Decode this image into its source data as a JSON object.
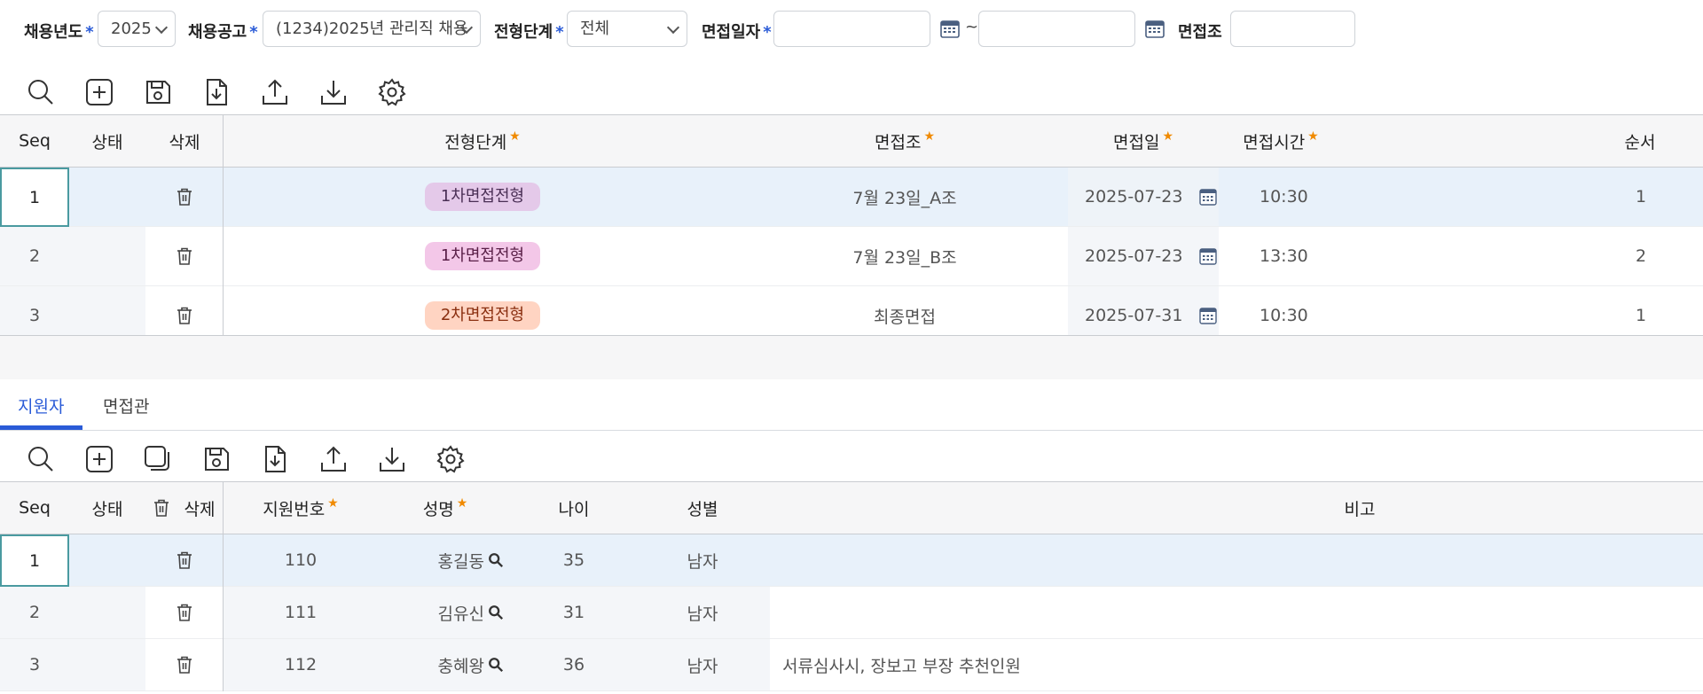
{
  "filters": {
    "year_label": "채용년도",
    "year_value": "2025",
    "notice_label": "채용공고",
    "notice_value": "(1234)2025년 관리직 채용",
    "stage_label": "전형단계",
    "stage_value": "전체",
    "date_label": "면접일자",
    "date_from": "",
    "date_to": "",
    "tilde": "~",
    "group_label": "면접조",
    "group_value": "",
    "required_mark": "*"
  },
  "toolbar1": {
    "icons": [
      "search-icon",
      "add-icon",
      "save-icon",
      "export-file-icon",
      "upload-icon",
      "download-icon",
      "settings-icon"
    ]
  },
  "grid1": {
    "headers": {
      "seq": "Seq",
      "status": "상태",
      "delete": "삭제",
      "stage": "전형단계",
      "group": "면접조",
      "date": "면접일",
      "time": "면접시간",
      "order": "순서"
    },
    "rows": [
      {
        "seq": "1",
        "stage": "1차면접전형",
        "stage_color": "#e4c9e9",
        "group": "7월 23일_A조",
        "date": "2025-07-23",
        "time": "10:30",
        "order": "1"
      },
      {
        "seq": "2",
        "stage": "1차면접전형",
        "stage_color": "#f3c7e8",
        "group": "7월 23일_B조",
        "date": "2025-07-23",
        "time": "13:30",
        "order": "2"
      },
      {
        "seq": "3",
        "stage": "2차면접전형",
        "stage_color": "#ffd4c2",
        "group": "최종면접",
        "date": "2025-07-31",
        "time": "10:30",
        "order": "1"
      }
    ]
  },
  "tabs": {
    "applicants": "지원자",
    "interviewers": "면접관"
  },
  "toolbar2": {
    "icons": [
      "search-icon",
      "add-icon",
      "copy-icon",
      "save-icon",
      "export-file-icon",
      "upload-icon",
      "download-icon",
      "settings-icon"
    ]
  },
  "grid2": {
    "headers": {
      "seq": "Seq",
      "status": "상태",
      "delete": "삭제",
      "applicant_no": "지원번호",
      "name": "성명",
      "age": "나이",
      "gender": "성별",
      "note": "비고"
    },
    "rows": [
      {
        "seq": "1",
        "applicant_no": "110",
        "name": "홍길동",
        "age": "35",
        "gender": "남자",
        "note": ""
      },
      {
        "seq": "2",
        "applicant_no": "111",
        "name": "김유신",
        "age": "31",
        "gender": "남자",
        "note": ""
      },
      {
        "seq": "3",
        "applicant_no": "112",
        "name": "충혜왕",
        "age": "36",
        "gender": "남자",
        "note": "서류심사시, 장보고 부장 추천인원"
      }
    ]
  },
  "colors": {
    "accent": "#2a5bd7",
    "required_star": "#f08a00",
    "selected_row": "#e8f1fa"
  }
}
